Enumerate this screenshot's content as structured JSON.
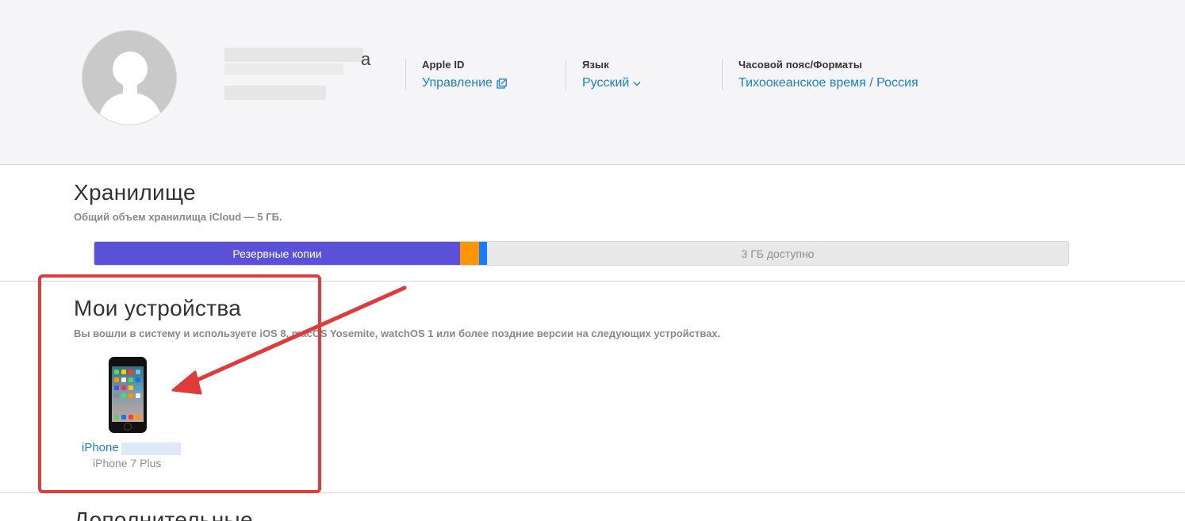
{
  "header": {
    "name_suffix": "а",
    "apple_id": {
      "label": "Apple ID",
      "link": "Управление"
    },
    "language": {
      "label": "Язык",
      "link": "Русский"
    },
    "timezone": {
      "label": "Часовой пояс/Форматы",
      "link": "Тихоокеанское время / Россия"
    }
  },
  "storage": {
    "title": "Хранилище",
    "subtitle": "Общий объем хранилища iCloud — 5 ГБ.",
    "bar": {
      "backup_label": "Резервные копии",
      "free_label": "3 ГБ доступно",
      "colors": {
        "backup": "#5b51d8",
        "orange": "#ff9500",
        "blue": "#147eff",
        "free": "#e8e8e8"
      }
    }
  },
  "devices": {
    "title": "Мои устройства",
    "subtitle": "Вы вошли в систему и используете iOS 8, macOS Yosemite, watchOS 1 или более поздние версии на следующих устройствах.",
    "items": [
      {
        "name": "iPhone",
        "model": "iPhone 7 Plus"
      }
    ]
  },
  "additional": {
    "title": "Дополнительные"
  },
  "icons": [
    "avatar-silhouette-icon",
    "external-link-icon",
    "chevron-down-icon",
    "iphone-icon"
  ],
  "annotation": {
    "color": "#e03a3a"
  }
}
